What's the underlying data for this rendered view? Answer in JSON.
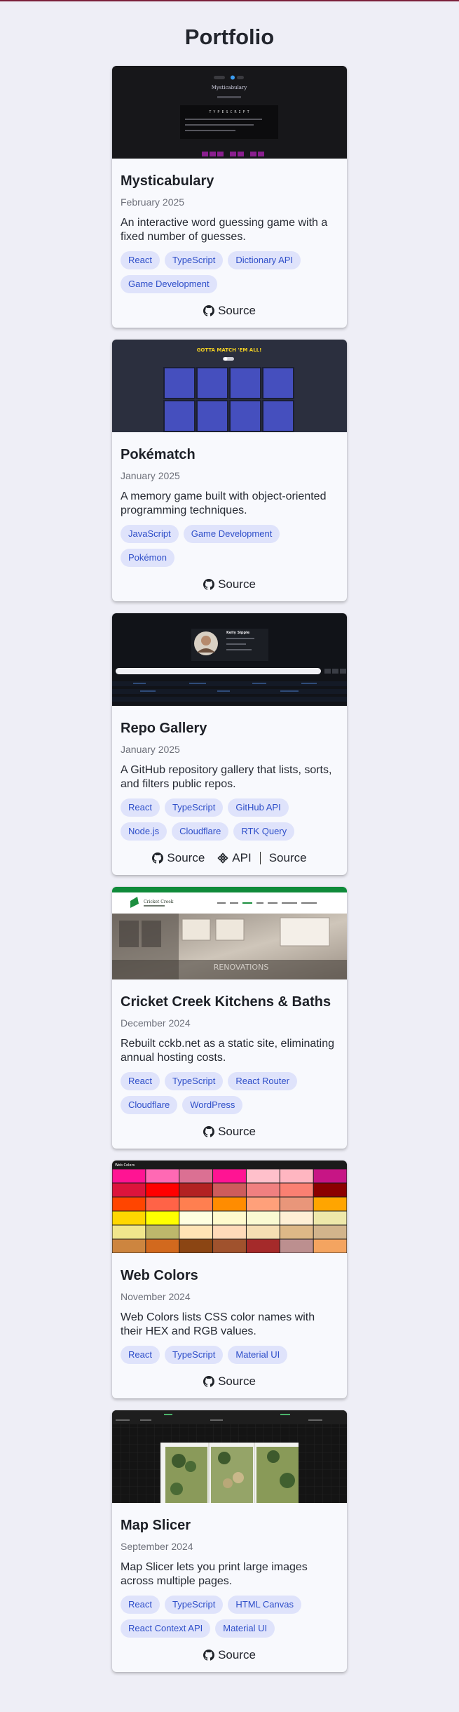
{
  "page": {
    "title": "Portfolio"
  },
  "projects": [
    {
      "title": "Mysticabulary",
      "date": "February 2025",
      "description": "An interactive word guessing game with a fixed number of guesses.",
      "tags": [
        "React",
        "TypeScript",
        "Dictionary API",
        "Game Development"
      ],
      "links": [
        "Source"
      ],
      "thumb": {
        "heading": "Mysticabulary",
        "letters": "T Y P E S C R I P T"
      }
    },
    {
      "title": "Pokématch",
      "date": "January 2025",
      "description": "A memory game built with object-oriented programming techniques.",
      "tags": [
        "JavaScript",
        "Game Development",
        "Pokémon"
      ],
      "links": [
        "Source"
      ],
      "thumb": {
        "heading": "GOTTA MATCH 'EM ALL!"
      }
    },
    {
      "title": "Repo Gallery",
      "date": "January 2025",
      "description": "A GitHub repository gallery that lists, sorts, and filters public repos.",
      "tags": [
        "React",
        "TypeScript",
        "GitHub API",
        "Node.js",
        "Cloudflare",
        "RTK Query"
      ],
      "links": [
        "Source",
        "API",
        "Source"
      ],
      "thumb": {
        "name": "Kelly Sipple"
      }
    },
    {
      "title": "Cricket Creek Kitchens & Baths",
      "date": "December 2024",
      "description": "Rebuilt cckb.net as a static site, eliminating annual hosting costs.",
      "tags": [
        "React",
        "TypeScript",
        "React Router",
        "Cloudflare",
        "WordPress"
      ],
      "links": [
        "Source"
      ],
      "thumb": {
        "brand": "Cricket Creek",
        "overlay": "RENOVATIONS"
      }
    },
    {
      "title": "Web Colors",
      "date": "November 2024",
      "description": "Web Colors lists CSS color names with their HEX and RGB values.",
      "tags": [
        "React",
        "TypeScript",
        "Material UI"
      ],
      "links": [
        "Source"
      ],
      "thumb": {
        "heading": "Web Colors"
      }
    },
    {
      "title": "Map Slicer",
      "date": "September 2024",
      "description": "Map Slicer lets you print large images across multiple pages.",
      "tags": [
        "React",
        "TypeScript",
        "HTML Canvas",
        "React Context API",
        "Material UI"
      ],
      "links": [
        "Source"
      ],
      "thumb": {}
    }
  ],
  "colors": {
    "background": "#eeeef6",
    "card": "#f8f9fd",
    "tag_bg": "#dfe3fb",
    "tag_text": "#2f4fc9",
    "top_border": "#7b1f3a"
  },
  "icons": {
    "source": "github-icon",
    "api": "api-icon"
  }
}
